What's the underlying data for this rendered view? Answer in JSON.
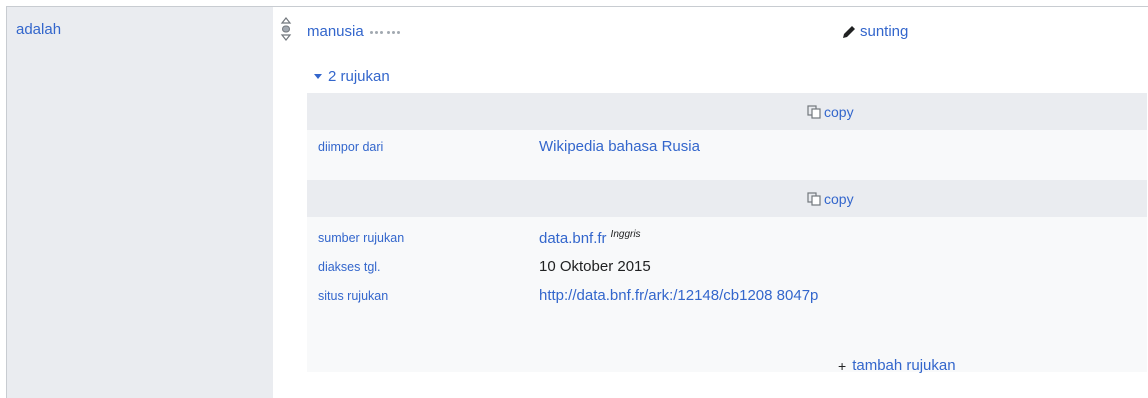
{
  "property": {
    "label": "adalah"
  },
  "statement": {
    "value": "manusia",
    "rank_icon": "rank-normal-icon",
    "edit_label": "sunting",
    "edit_icon": "pencil-icon"
  },
  "references": {
    "toggle_label": "2 rujukan",
    "items": [
      {
        "copy_label": "copy",
        "rows": [
          {
            "key": "diimpor dari",
            "value": "Wikipedia bahasa Rusia"
          }
        ]
      },
      {
        "copy_label": "copy",
        "rows": [
          {
            "key": "sumber rujukan",
            "value": "data.bnf.fr",
            "lang": "Inggris"
          },
          {
            "key": "diakses tgl.",
            "value": "10 Oktober 2015"
          },
          {
            "key": "situs rujukan",
            "value": "http://data.bnf.fr/ark:/12148/cb1208 8047p"
          }
        ]
      }
    ],
    "add_label": "tambah rujukan"
  },
  "colors": {
    "link": "#3366cc",
    "property_bg": "#eaecf0",
    "ref_header_bg": "#eaecf0",
    "ref_body_bg": "#f8f9fa",
    "text": "#202122"
  }
}
